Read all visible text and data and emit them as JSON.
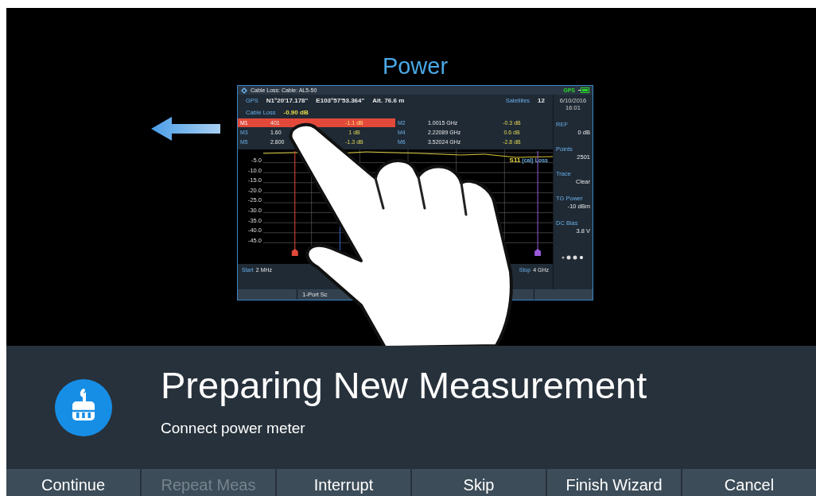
{
  "title": "Power",
  "instrument": {
    "header": "Cable Loss:  Cable: AL5-50",
    "gps_status": "GPS",
    "gps": {
      "label": "GPS",
      "latitude": "N1°20'17.178\"",
      "longitude": "E103°57'53.364\"",
      "altitude": "Alt. 76.6 m",
      "satellites_label": "Satellites",
      "satellites": "12"
    },
    "cable_loss": {
      "label": "Cable Loss",
      "value": "-0.90 dB"
    },
    "markers": [
      {
        "label": "M1",
        "frequency": "401",
        "value": "-1.1 dB",
        "selected": true
      },
      {
        "label": "M2",
        "frequency": "1.0015 GHz",
        "value": "-0.3 dB",
        "selected": false
      },
      {
        "label": "M3",
        "frequency": "1.60",
        "value": "1 dB",
        "selected": false
      },
      {
        "label": "M4",
        "frequency": "2.22089 GHz",
        "value": "0.6 dB",
        "selected": false
      },
      {
        "label": "M5",
        "frequency": "2.800",
        "value": "-1.3 dB",
        "selected": false
      },
      {
        "label": "M6",
        "frequency": "3.52024 GHz",
        "value": "-2.8 dB",
        "selected": false
      }
    ],
    "y_ticks": [
      "-5.0",
      "-10.0",
      "-15.0",
      "-20.0",
      "-25.0",
      "-30.0",
      "-35.0",
      "-40.0",
      "-45.0"
    ],
    "trace_label": {
      "name": "S11",
      "unit": "(cal) Loss"
    },
    "start": {
      "label": "Start",
      "value": "2 MHz"
    },
    "stop": {
      "label": "Stop",
      "value": "4 GHz"
    },
    "date": "6/10/2016",
    "time": "16:01",
    "settings": [
      {
        "label": "REF",
        "value": "0 dB"
      },
      {
        "label": "Points",
        "value": "2501"
      },
      {
        "label": "Trace",
        "value": "Clear"
      },
      {
        "label": "TG Power",
        "value": "-10 dBm"
      },
      {
        "label": "DC Bias",
        "value": "3.8 V"
      }
    ],
    "softkeys": [
      {
        "label": "1-Port Sc"
      }
    ]
  },
  "heading": "Preparing New Measurement",
  "instruction": "Connect power meter",
  "buttons": [
    {
      "label": "Continue",
      "disabled": false
    },
    {
      "label": "Repeat Meas",
      "disabled": true
    },
    {
      "label": "Interrupt",
      "disabled": false
    },
    {
      "label": "Skip",
      "disabled": false
    },
    {
      "label": "Finish Wizard",
      "disabled": false
    },
    {
      "label": "Cancel",
      "disabled": false
    }
  ]
}
